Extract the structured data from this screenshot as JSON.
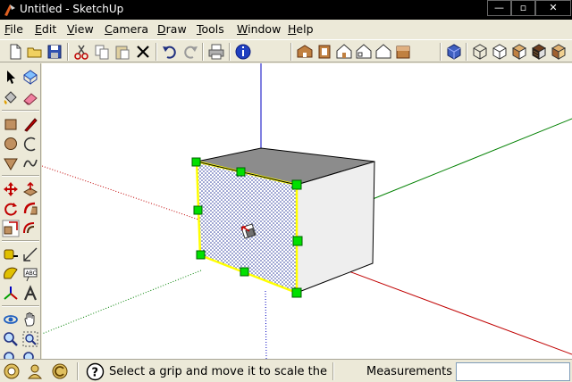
{
  "window": {
    "title": "Untitled - SketchUp",
    "minimize": "—",
    "maximize": "▫",
    "close": "✕"
  },
  "menu": [
    {
      "label": "File",
      "ul": "F",
      "rest": "ile"
    },
    {
      "label": "Edit",
      "ul": "E",
      "rest": "dit"
    },
    {
      "label": "View",
      "ul": "V",
      "rest": "iew"
    },
    {
      "label": "Camera",
      "ul": "C",
      "rest": "amera"
    },
    {
      "label": "Draw",
      "ul": "D",
      "rest": "raw"
    },
    {
      "label": "Tools",
      "ul": "T",
      "rest": "ools"
    },
    {
      "label": "Window",
      "ul": "W",
      "rest": "indow"
    },
    {
      "label": "Help",
      "ul": "H",
      "rest": "elp"
    }
  ],
  "status": {
    "hint": "Select a grip and move it to scale the c",
    "measurements_label": "Measurements",
    "measurements_value": ""
  },
  "colors": {
    "axis_red": "#c00000",
    "axis_green": "#008000",
    "axis_blue": "#0000c0",
    "grip": "#00e000",
    "selection": "#ffff00",
    "face_top": "#8c8c8c",
    "face_side": "#eeeeee",
    "face_front": "#ffffff"
  }
}
